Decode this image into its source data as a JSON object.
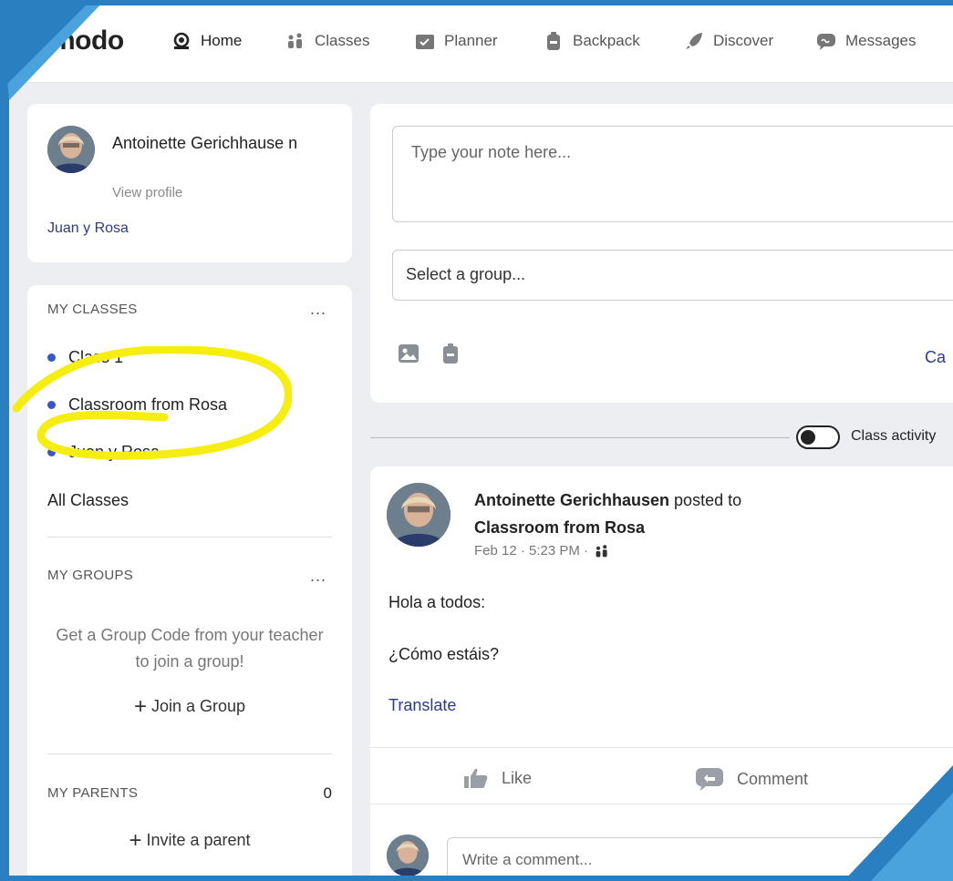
{
  "brand": {
    "logo_text": "modo"
  },
  "nav": {
    "home": "Home",
    "classes": "Classes",
    "planner": "Planner",
    "backpack": "Backpack",
    "discover": "Discover",
    "messages": "Messages"
  },
  "profile": {
    "name": "Antoinette Gerichhause n",
    "view_profile": "View profile",
    "group": "Juan y Rosa"
  },
  "my_classes": {
    "title": "MY CLASSES",
    "more": "...",
    "items": [
      {
        "label": "Class 1"
      },
      {
        "label": "Classroom from Rosa"
      },
      {
        "label": "Juan y Rosa"
      }
    ],
    "all_classes": "All Classes"
  },
  "my_groups": {
    "title": "MY GROUPS",
    "more": "...",
    "message": "Get a Group Code from your teacher to join a group!",
    "join": "Join a Group"
  },
  "my_parents": {
    "title": "MY PARENTS",
    "count": "0",
    "invite": "Invite a parent"
  },
  "composer": {
    "note_placeholder": "Type your note here...",
    "group_placeholder": "Select a group...",
    "cancel": "Ca"
  },
  "activity": {
    "toggle_label": "Class activity"
  },
  "post": {
    "author": "Antoinette Gerichhausen",
    "posted_to": "posted to",
    "class": "Classroom from Rosa",
    "date": "Feb 12 · 5:23 PM ·",
    "line1": "Hola a todos:",
    "line2": "¿Cómo estáis?",
    "translate": "Translate",
    "like": "Like",
    "comment": "Comment",
    "comment_placeholder": "Write a comment..."
  },
  "colors": {
    "accent": "#2b3a8c",
    "dot": "#3a56c9",
    "highlight": "#f6ee12",
    "frame_blue": "#2a7fc0"
  }
}
